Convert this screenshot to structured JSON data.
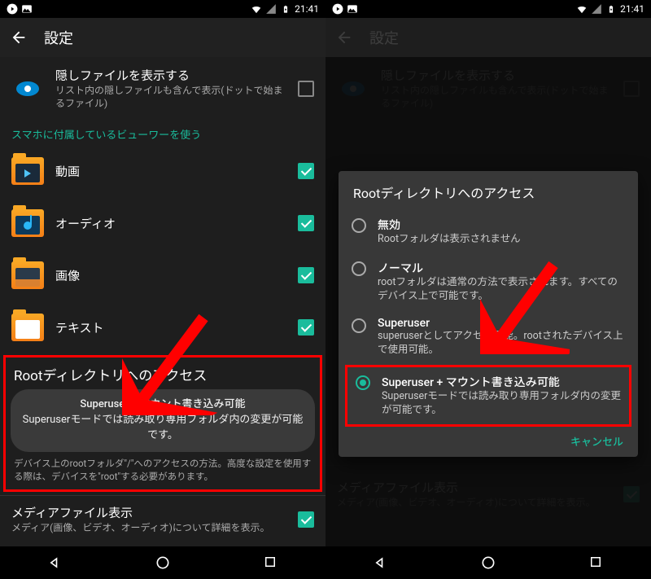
{
  "status": {
    "time": "21:41"
  },
  "app": {
    "title": "設定"
  },
  "hidden_files": {
    "title": "隠しファイルを表示する",
    "sub": "リスト内の隠しファイルも含んで表示(ドットで始まるファイル)"
  },
  "viewer_section": "スマホに付属しているビューワーを使う",
  "viewers": {
    "video": "動画",
    "audio": "オーディオ",
    "image": "画像",
    "text": "テキスト"
  },
  "root_access": {
    "title": "Rootディレクトリへのアクセス",
    "toast_title": "Superuser + マウント書き込み可能",
    "toast_body": "Superuserモードでは読み取り専用フォルダ内の変更が可能です。",
    "desc": "デバイス上のrootフォルダ\"/\"へのアクセスの方法。高度な設定を使用する際は、デバイスを\"root\"する必要があります。"
  },
  "media": {
    "title": "メディアファイル表示",
    "sub": "メディア(画像、ビデオ、オーディオ)について詳細を表示。"
  },
  "dialog": {
    "title": "Rootディレクトリへのアクセス",
    "opt1_title": "無効",
    "opt1_sub": "Rootフォルダは表示されません",
    "opt2_title": "ノーマル",
    "opt2_sub": "rootフォルダは通常の方法で表示されます。すべてのデバイス上で可能です。",
    "opt3_title": "Superuser",
    "opt3_sub": "superuserとしてアクセス可能。rootされたデバイス上で使用可能。",
    "opt4_title": "Superuser + マウント書き込み可能",
    "opt4_sub": "Superuserモードでは読み取り専用フォルダ内の変更が可能です。",
    "cancel": "キャンセル"
  }
}
